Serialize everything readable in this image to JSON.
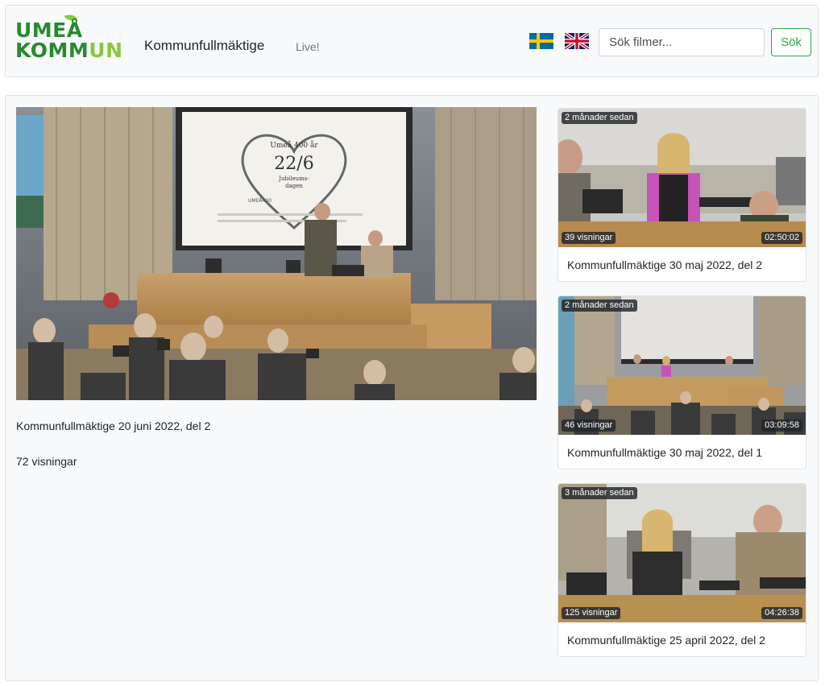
{
  "header": {
    "logo": {
      "line1": "UMEÅ",
      "line2_a": "KOMM",
      "line2_b": "UN"
    },
    "title": "Kommunfullmäktige",
    "live_label": "Live!",
    "search_placeholder": "Sök filmer...",
    "search_button": "Sök",
    "flags": [
      "swedish-flag-icon",
      "british-flag-icon"
    ]
  },
  "main_video": {
    "title": "Kommunfullmäktige 20 juni 2022, del 2",
    "views": "72 visningar",
    "screen_text": {
      "line1": "Umeå 400 år",
      "line2": "22/6",
      "line3": "Jubileums-",
      "line4": "dagen",
      "brand": "UMEÅ400"
    }
  },
  "video_cards": [
    {
      "age": "2 månader sedan",
      "views": "39 visningar",
      "duration": "02:50:02",
      "title": "Kommunfullmäktige 30 maj 2022, del 2"
    },
    {
      "age": "2 månader sedan",
      "views": "46 visningar",
      "duration": "03:09:58",
      "title": "Kommunfullmäktige 30 maj 2022, del 1"
    },
    {
      "age": "3 månader sedan",
      "views": "125 visningar",
      "duration": "04:26:38",
      "title": "Kommunfullmäktige 25 april 2022, del 2"
    }
  ],
  "colors": {
    "brand_green": "#2a8a2e",
    "brand_lime": "#8cc63f",
    "success": "#28a745",
    "panel": "#f8f9fa",
    "border": "#dee2e6"
  }
}
